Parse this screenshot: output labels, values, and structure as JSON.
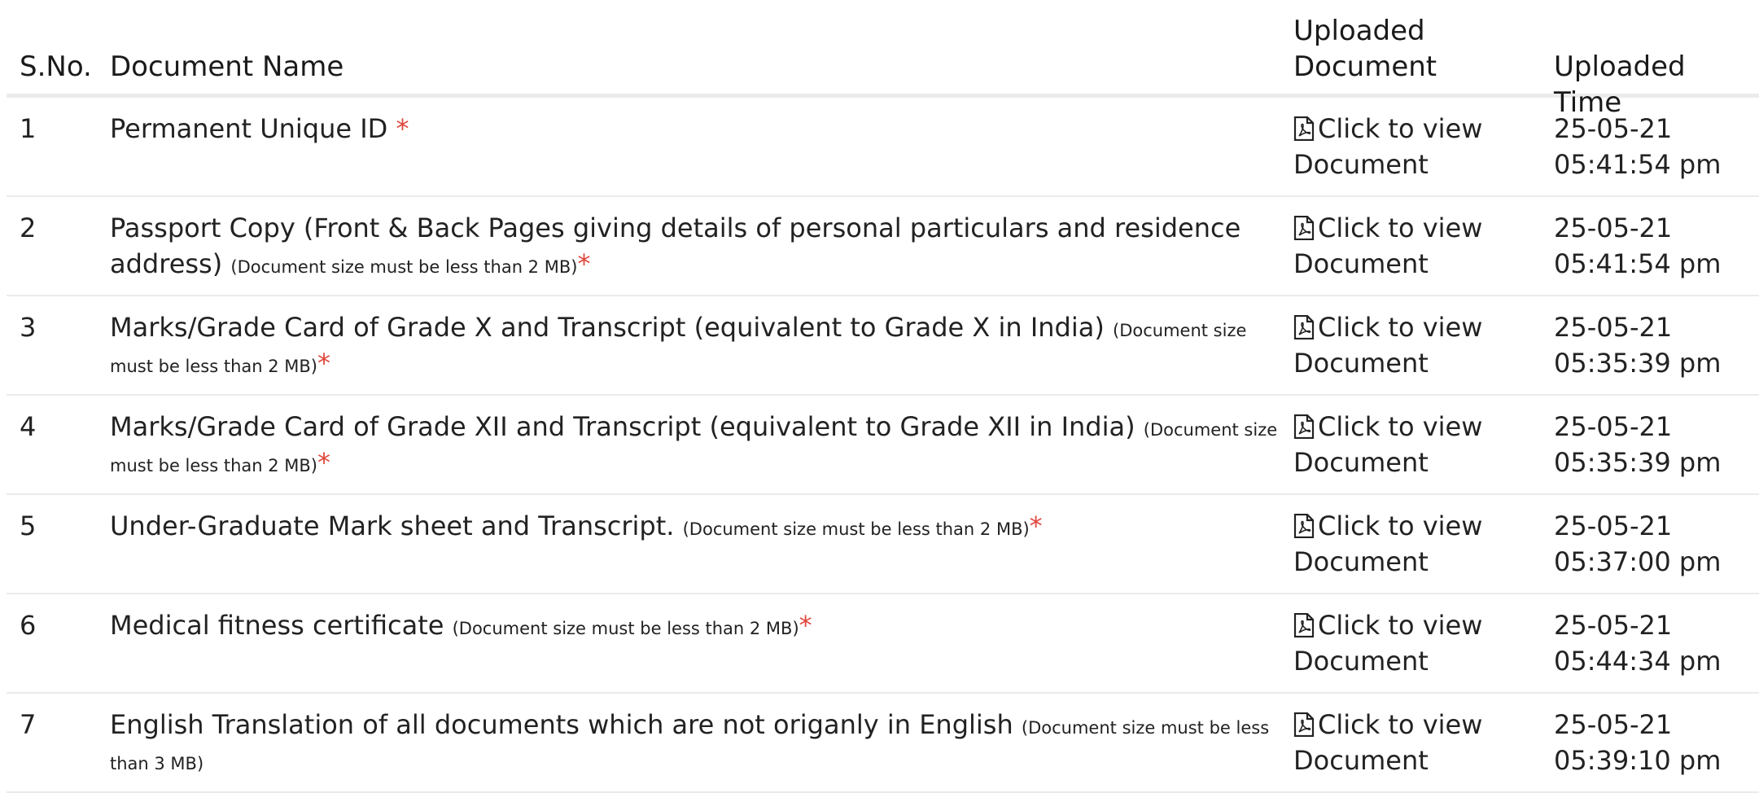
{
  "table": {
    "headers": {
      "sno": "S.No.",
      "name": "Document Name",
      "uploaded": "Uploaded Document",
      "time": "Uploaded Time"
    },
    "rows": [
      {
        "sno": "1",
        "name": "Permanent Unique ID",
        "note": "",
        "required": "*",
        "link": "Click to view Document",
        "time": "25-05-21 05:41:54 pm"
      },
      {
        "sno": "2",
        "name": "Passport Copy (Front & Back Pages giving details of personal particulars and residence address)",
        "note": "(Document size must be less than 2 MB)",
        "required": "*",
        "link": "Click to view Document",
        "time": "25-05-21 05:41:54 pm"
      },
      {
        "sno": "3",
        "name": "Marks/Grade Card of Grade X and Transcript (equivalent to Grade X in India)",
        "note": "(Document size must be less than 2 MB)",
        "required": "*",
        "link": "Click to view Document",
        "time": "25-05-21 05:35:39 pm"
      },
      {
        "sno": "4",
        "name": "Marks/Grade Card of Grade XII and Transcript (equivalent to Grade XII in India)",
        "note": "(Document size must be less than 2 MB)",
        "required": "*",
        "link": "Click to view Document",
        "time": "25-05-21 05:35:39 pm"
      },
      {
        "sno": "5",
        "name": "Under-Graduate Mark sheet and Transcript.",
        "note": "(Document size must be less than 2 MB)",
        "required": "*",
        "link": "Click to view Document",
        "time": "25-05-21 05:37:00 pm"
      },
      {
        "sno": "6",
        "name": "Medical fitness certificate",
        "note": "(Document size must be less than 2 MB)",
        "required": "*",
        "link": "Click to view Document",
        "time": "25-05-21 05:44:34 pm"
      },
      {
        "sno": "7",
        "name": "English Translation of all documents which are not origanly in English",
        "note": "(Document size must be less than 3 MB)",
        "required": "",
        "link": "Click to view Document",
        "time": "25-05-21 05:39:10 pm"
      }
    ]
  },
  "icons": {
    "document_link": "file-pdf-icon"
  },
  "colors": {
    "required_star": "#e0473c",
    "row_border": "#ebebeb"
  }
}
